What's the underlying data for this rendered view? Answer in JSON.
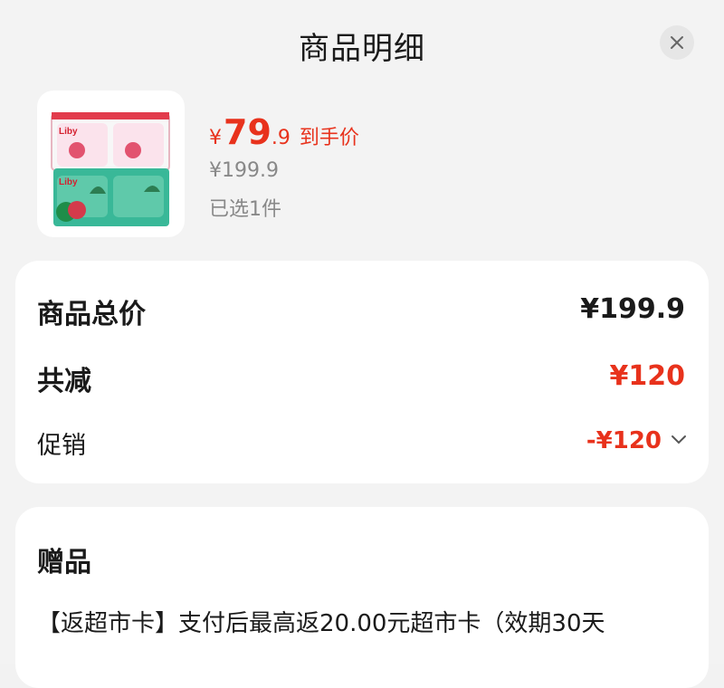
{
  "header": {
    "title": "商品明细"
  },
  "product": {
    "price_symbol": "¥",
    "price_int": "79",
    "price_dec": ".9",
    "price_tag": "到手价",
    "original_price": "¥199.9",
    "selected_qty": "已选1件",
    "brand_text": "Liby"
  },
  "summary": {
    "total_label": "商品总价",
    "total_value": "¥199.9",
    "discount_label": "共减",
    "discount_value": "¥120",
    "promo_label": "促销",
    "promo_value": "-¥120"
  },
  "gift": {
    "title": "赠品",
    "description": "【返超市卡】支付后最高返20.00元超市卡（效期30天"
  },
  "colors": {
    "accent_red": "#e8321c",
    "muted": "#888888"
  }
}
